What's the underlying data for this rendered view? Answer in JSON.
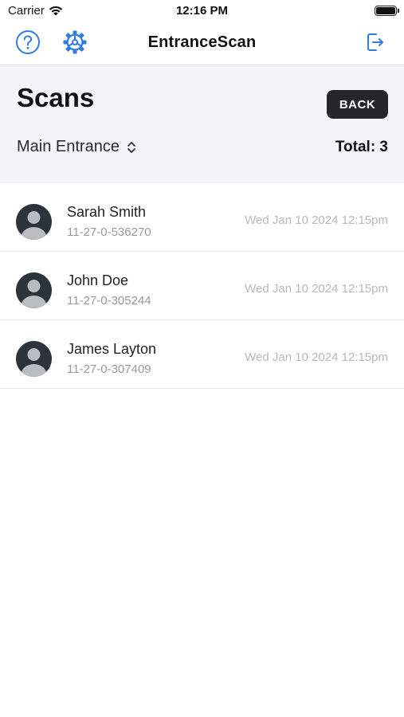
{
  "status_bar": {
    "carrier": "Carrier",
    "time": "12:16 PM"
  },
  "nav": {
    "title": "EntranceScan"
  },
  "colors": {
    "accent": "#2f7de1",
    "button_dark": "#24262b",
    "panel_bg": "#f4f5f8",
    "avatar_bg": "#2c333a"
  },
  "icons": {
    "help": "question-circle-icon",
    "settings": "gear-icon",
    "logout": "logout-icon",
    "location_picker": "chevron-up-down-icon"
  },
  "header": {
    "title": "Scans",
    "back_label": "BACK",
    "location": "Main Entrance",
    "total": "Total: 3"
  },
  "scans": [
    {
      "name": "Sarah Smith",
      "code": "11-27-0-536270",
      "timestamp": "Wed Jan 10 2024 12:15pm"
    },
    {
      "name": "John Doe",
      "code": "11-27-0-305244",
      "timestamp": "Wed Jan 10 2024 12:15pm"
    },
    {
      "name": "James Layton",
      "code": "11-27-0-307409",
      "timestamp": "Wed Jan 10 2024 12:15pm"
    }
  ]
}
